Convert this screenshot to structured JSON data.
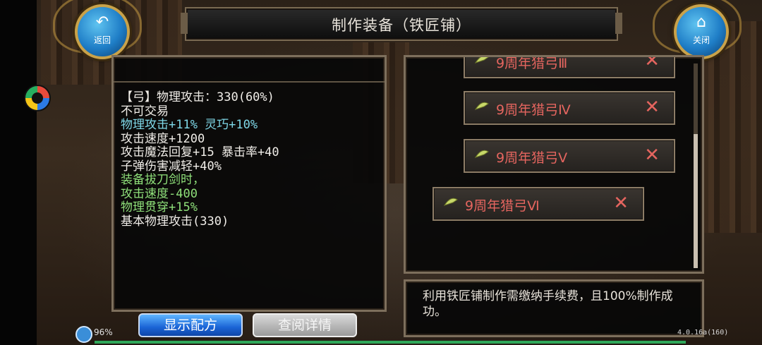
{
  "header": {
    "title": "制作装备（铁匠铺）",
    "back_label": "返回",
    "close_label": "关闭"
  },
  "item_stats": [
    {
      "text": "【弓】物理攻击：330(60%)",
      "color": "#f0ede8"
    },
    {
      "text": "不可交易",
      "color": "#f0ede8"
    },
    {
      "text": "物理攻击+11% 灵巧+10%",
      "color": "#7fd8e8"
    },
    {
      "text": "攻击速度+1200",
      "color": "#f0ede8"
    },
    {
      "text": "攻击魔法回复+15 暴击率+40",
      "color": "#f0ede8"
    },
    {
      "text": "子弹伤害减轻+40%",
      "color": "#f0ede8"
    },
    {
      "text": "装备拔刀剑时，",
      "color": "#8fe07a"
    },
    {
      "text": "攻击速度-400",
      "color": "#8fe07a"
    },
    {
      "text": "物理贯穿+15%",
      "color": "#8fe07a"
    },
    {
      "text": "基本物理攻击(330)",
      "color": "#f0ede8"
    }
  ],
  "recipe_list": [
    {
      "name": "9周年猎弓Ⅲ"
    },
    {
      "name": "9周年猎弓Ⅳ"
    },
    {
      "name": "9周年猎弓Ⅴ"
    },
    {
      "name": "9周年猎弓Ⅵ"
    }
  ],
  "description": "利用铁匠铺制作需缴纳手续费，且100%制作成功。",
  "buttons": {
    "show_formula": "显示配方",
    "view_details": "查阅详情"
  },
  "status": {
    "battery_percent": "96%",
    "version": "4.0.16a(160)"
  },
  "colors": {
    "recipe_text": "#e5655f",
    "stat_cyan": "#7fd8e8",
    "stat_green": "#8fe07a",
    "primary_button": "#1a64d6"
  }
}
